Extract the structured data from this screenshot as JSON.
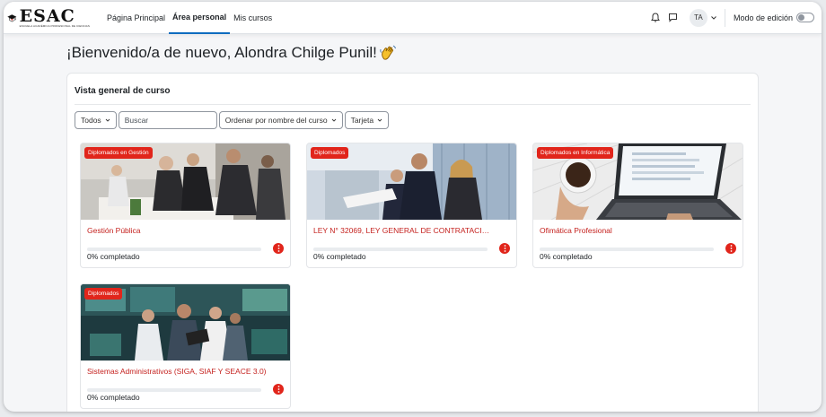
{
  "logo": {
    "word": "ESAC",
    "sub": "ESCUELA ACADÉMICA PROFESIONAL DE CIENCIAS"
  },
  "nav": {
    "links": [
      "Página Principal",
      "Área personal",
      "Mis cursos"
    ],
    "active": "Área personal",
    "avatar": "TA",
    "edit_mode_label": "Modo de edición"
  },
  "welcome": "¡Bienvenido/a de nuevo, Alondra Chilge Punil!",
  "overview": {
    "title": "Vista general de curso",
    "filter_all": "Todos",
    "search_placeholder": "Buscar",
    "sort_label": "Ordenar por nombre del curso",
    "view_label": "Tarjeta"
  },
  "colors": {
    "brand_red": "#e1251b",
    "link_red": "#c5221f",
    "accent_blue": "#0f6cbf"
  },
  "courses": [
    {
      "category": "Diplomados en Gestión",
      "name": "Gestión Pública",
      "progress_text": "0% completado",
      "progress": 0
    },
    {
      "category": "Diplomados",
      "name": "LEY N° 32069, LEY GENERAL DE CONTRATACIONES ...",
      "progress_text": "0% completado",
      "progress": 0
    },
    {
      "category": "Diplomados en Informática",
      "name": "Ofimática Profesional",
      "progress_text": "0% completado",
      "progress": 0
    },
    {
      "category": "Diplomados",
      "name": "Sistemas Administrativos (SIGA, SIAF Y SEACE 3.0)",
      "progress_text": "0% completado",
      "progress": 0
    }
  ]
}
